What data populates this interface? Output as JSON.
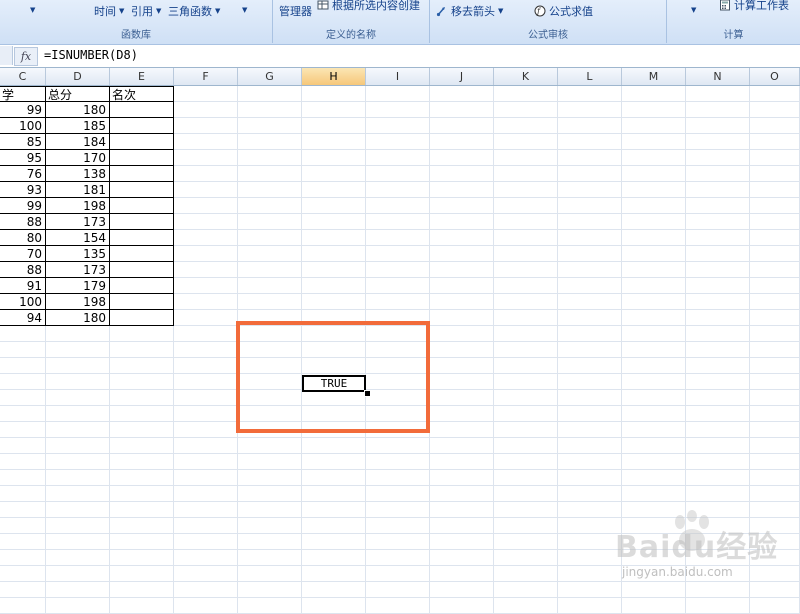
{
  "ribbon": {
    "function_library": {
      "datetime": "时间",
      "lookup": "引用",
      "math": "三角函数",
      "label": "函数库"
    },
    "defined_names": {
      "manager": "管理器",
      "create_from_selection": "根据所选内容创建",
      "label": "定义的名称"
    },
    "formula_auditing": {
      "remove_arrows": "移去箭头",
      "evaluate_formula": "公式求值",
      "label": "公式审核"
    },
    "calculation": {
      "calculate_sheet": "计算工作表",
      "label": "计算"
    }
  },
  "formula_bar": {
    "fx": "fx",
    "formula": "=ISNUMBER(D8)"
  },
  "columns": [
    "C",
    "D",
    "E",
    "F",
    "G",
    "H",
    "I",
    "J",
    "K",
    "L",
    "M",
    "N",
    "O"
  ],
  "active_column": "H",
  "table": {
    "headers": {
      "c": "学",
      "d": "总分",
      "e": "名次"
    },
    "rows": [
      {
        "c": "99",
        "d": "180"
      },
      {
        "c": "100",
        "d": "185"
      },
      {
        "c": "85",
        "d": "184"
      },
      {
        "c": "95",
        "d": "170"
      },
      {
        "c": "76",
        "d": "138"
      },
      {
        "c": "93",
        "d": "181"
      },
      {
        "c": "99",
        "d": "198"
      },
      {
        "c": "88",
        "d": "173"
      },
      {
        "c": "80",
        "d": "154"
      },
      {
        "c": "70",
        "d": "135"
      },
      {
        "c": "88",
        "d": "173"
      },
      {
        "c": "91",
        "d": "179"
      },
      {
        "c": "100",
        "d": "198"
      },
      {
        "c": "94",
        "d": "180"
      }
    ]
  },
  "result": {
    "value": "TRUE"
  },
  "watermark": {
    "brand": "Baidu经验",
    "site": "jingyan.baidu.com"
  },
  "colors": {
    "highlight": "#f26b3a",
    "active_header": "#f6c77a",
    "ribbon": "#cfe0f5"
  }
}
